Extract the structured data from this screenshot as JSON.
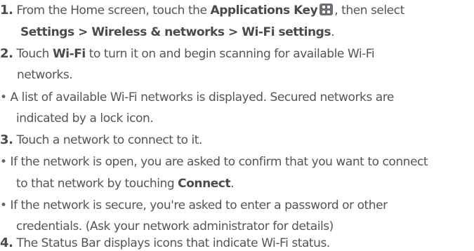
{
  "step1": {
    "number": "1.",
    "line1_prefix": "From the Home screen, touch the",
    "line1_bold": "Applications Key",
    "line1_suffix": ", then select",
    "line2_bold": "Settings > Wireless & networks > Wi-Fi settings",
    "line2_suffix": "."
  },
  "step2": {
    "number": "2.",
    "line1_prefix": "Touch",
    "line1_bold": "Wi-Fi",
    "line1_suffix": "to turn it on and begin scanning for available Wi-Fi",
    "line2": "networks."
  },
  "bullet1": {
    "marker": "•",
    "line1": "A list of available Wi-Fi networks is displayed. Secured networks are",
    "line2": "indicated by a lock icon."
  },
  "step3": {
    "number": "3.",
    "text": "Touch a network to connect to it."
  },
  "bullet2": {
    "marker": "•",
    "line1": "If the network is open, you are asked to confirm that you want to connect",
    "line2_prefix": "to that network by touching",
    "line2_bold": "Connect",
    "line2_suffix": "."
  },
  "bullet3": {
    "marker": "•",
    "line1": "If the network is secure, you're asked to enter a password or other",
    "line2": "credentials. (Ask your network administrator for details)"
  },
  "step4": {
    "number": "4.",
    "text": "The Status Bar displays icons that indicate Wi-Fi status."
  },
  "icons": {
    "applications_key": "applications-key-icon"
  }
}
